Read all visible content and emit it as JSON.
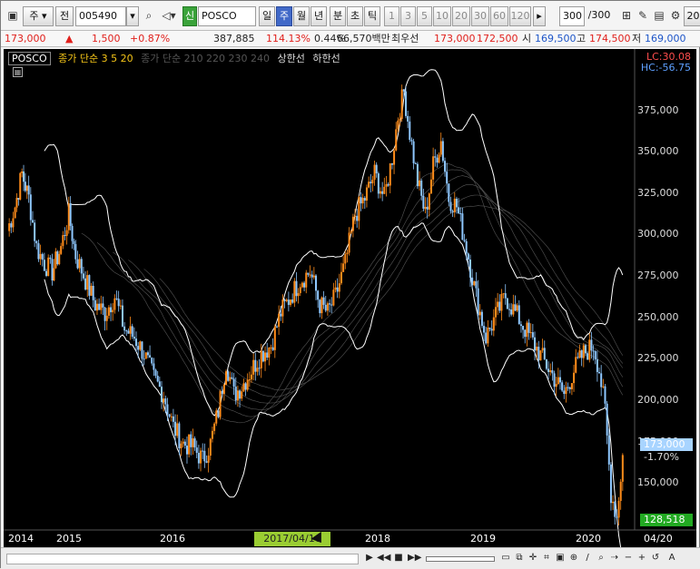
{
  "toolbar": {
    "period_mode": "주",
    "prev_label": "전",
    "stock_code": "005490",
    "credit_badge": "신",
    "stock_name": "POSCO",
    "period_tabs": [
      "일",
      "주",
      "월",
      "년",
      "분",
      "초",
      "틱"
    ],
    "interval_buttons": [
      "1",
      "3",
      "5",
      "10",
      "20",
      "30",
      "60",
      "120"
    ],
    "count_value": "300",
    "count_total": "/300",
    "right_label": "20"
  },
  "quote": {
    "price": "173,000",
    "change_arrow": "▲",
    "change": "1,500",
    "change_pct": "+0.87%",
    "volume": "387,885",
    "volume_ratio": "114.13%",
    "turnover_pct": "0.44%",
    "amount": "66,570백만",
    "best_label": "최우선",
    "best_ask": "173,000",
    "best_bid": "172,500",
    "open_label": "시",
    "open": "169,500",
    "high_label": "고",
    "high": "174,500",
    "low_label": "저",
    "low": "169,000"
  },
  "legend": {
    "name": "POSCO",
    "ma": "종가 단순 3 5 20",
    "ma2": "종가 단순 210 220 230 240",
    "upper": "상한선",
    "lower": "하한선"
  },
  "indicators": {
    "lc": "LC:30.08",
    "hc": "HC:-56.75"
  },
  "y_axis": [
    "375,000",
    "350,000",
    "325,000",
    "300,000",
    "275,000",
    "250,000",
    "225,000",
    "200,000",
    "175,000",
    "150,000"
  ],
  "current_price_tag": "173,000",
  "current_pct_tag": "-1.70%",
  "low_price_tag": "128,518",
  "x_axis": [
    "2014",
    "2015",
    "2016",
    "2018",
    "2019",
    "2020",
    "04/20"
  ],
  "cursor_date": "2017/04/10",
  "colors": {
    "up": "#ff8c1a",
    "down": "#8fc8ff",
    "band": "#ffffff",
    "ma_fan": "#555555",
    "accent": "#4169c8"
  },
  "chart_data": {
    "type": "candlestick",
    "x_range": [
      "2014-01",
      "2020-04"
    ],
    "ylim": [
      130000,
      410000
    ],
    "closes": [
      [
        2014.0,
        310000
      ],
      [
        2014.08,
        325000
      ],
      [
        2014.15,
        345000
      ],
      [
        2014.22,
        330000
      ],
      [
        2014.3,
        300000
      ],
      [
        2014.38,
        290000
      ],
      [
        2014.46,
        285000
      ],
      [
        2014.55,
        300000
      ],
      [
        2014.63,
        320000
      ],
      [
        2014.7,
        295000
      ],
      [
        2014.8,
        280000
      ],
      [
        2014.9,
        265000
      ],
      [
        2015.0,
        260000
      ],
      [
        2015.1,
        270000
      ],
      [
        2015.2,
        250000
      ],
      [
        2015.3,
        245000
      ],
      [
        2015.4,
        235000
      ],
      [
        2015.5,
        220000
      ],
      [
        2015.6,
        210000
      ],
      [
        2015.7,
        190000
      ],
      [
        2015.8,
        180000
      ],
      [
        2015.9,
        178000
      ],
      [
        2016.0,
        170000
      ],
      [
        2016.08,
        180000
      ],
      [
        2016.16,
        200000
      ],
      [
        2016.24,
        230000
      ],
      [
        2016.32,
        210000
      ],
      [
        2016.4,
        215000
      ],
      [
        2016.5,
        225000
      ],
      [
        2016.6,
        235000
      ],
      [
        2016.7,
        240000
      ],
      [
        2016.8,
        260000
      ],
      [
        2016.9,
        270000
      ],
      [
        2017.0,
        280000
      ],
      [
        2017.1,
        285000
      ],
      [
        2017.2,
        265000
      ],
      [
        2017.28,
        260000
      ],
      [
        2017.36,
        270000
      ],
      [
        2017.46,
        290000
      ],
      [
        2017.56,
        320000
      ],
      [
        2017.66,
        330000
      ],
      [
        2017.76,
        345000
      ],
      [
        2017.86,
        330000
      ],
      [
        2017.94,
        355000
      ],
      [
        2018.0,
        380000
      ],
      [
        2018.06,
        395000
      ],
      [
        2018.12,
        370000
      ],
      [
        2018.2,
        340000
      ],
      [
        2018.28,
        320000
      ],
      [
        2018.36,
        350000
      ],
      [
        2018.44,
        365000
      ],
      [
        2018.52,
        330000
      ],
      [
        2018.6,
        325000
      ],
      [
        2018.7,
        300000
      ],
      [
        2018.8,
        270000
      ],
      [
        2018.9,
        245000
      ],
      [
        2019.0,
        258000
      ],
      [
        2019.1,
        270000
      ],
      [
        2019.2,
        260000
      ],
      [
        2019.3,
        250000
      ],
      [
        2019.4,
        240000
      ],
      [
        2019.5,
        230000
      ],
      [
        2019.6,
        220000
      ],
      [
        2019.7,
        210000
      ],
      [
        2019.8,
        225000
      ],
      [
        2019.9,
        235000
      ],
      [
        2020.0,
        240000
      ],
      [
        2020.06,
        225000
      ],
      [
        2020.12,
        200000
      ],
      [
        2020.18,
        150000
      ],
      [
        2020.24,
        135000
      ],
      [
        2020.3,
        173000
      ]
    ]
  }
}
